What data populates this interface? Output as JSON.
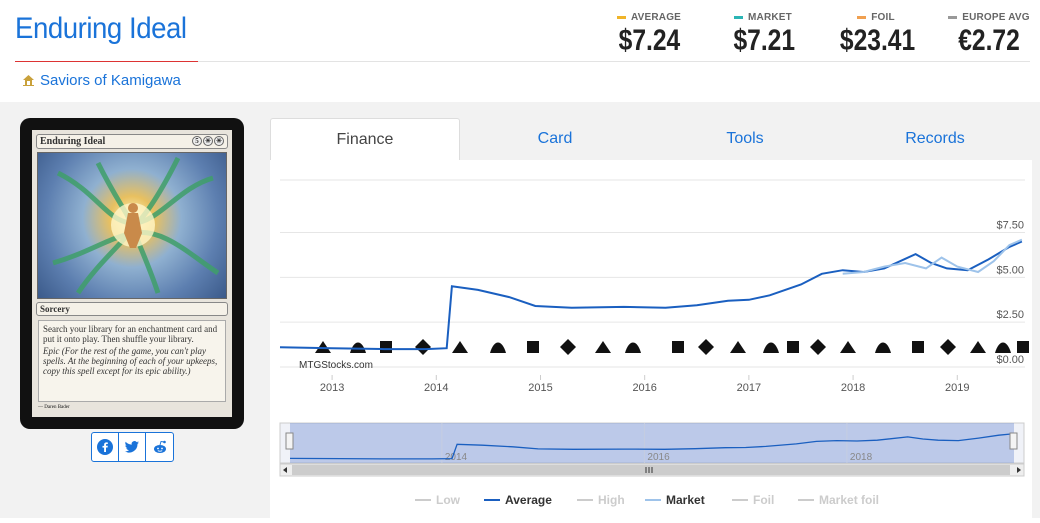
{
  "card": {
    "title": "Enduring Ideal",
    "set_name": "Saviors of Kamigawa",
    "image": {
      "name": "Enduring Ideal",
      "mana": [
        "5",
        "W",
        "W"
      ],
      "type_line": "Sorcery",
      "rules_text": "Search your library for an enchantment card and put it onto play. Then shuffle your library.",
      "epic_text": "Epic (For the rest of the game, you can't play spells. At the beginning of each of your upkeeps, copy this spell except for its epic ability.)",
      "artist": "Daren Bader"
    }
  },
  "prices": [
    {
      "label": "AVERAGE",
      "value": "$7.24",
      "color": "#f0b429"
    },
    {
      "label": "MARKET",
      "value": "$7.21",
      "color": "#2bb5b5"
    },
    {
      "label": "FOIL",
      "value": "$23.41",
      "color": "#f0a050"
    },
    {
      "label": "EUROPE AVG",
      "value": "€2.72",
      "color": "#999999"
    }
  ],
  "tabs": [
    {
      "label": "Finance",
      "active": true
    },
    {
      "label": "Card",
      "active": false
    },
    {
      "label": "Tools",
      "active": false
    },
    {
      "label": "Records",
      "active": false
    }
  ],
  "share": [
    "facebook-icon",
    "twitter-icon",
    "reddit-icon"
  ],
  "chart_data": {
    "type": "line",
    "watermark": "MTGStocks.com",
    "ylim": [
      0,
      8.2
    ],
    "y_ticks": [
      {
        "value": 0,
        "label": "$0.00"
      },
      {
        "value": 2.5,
        "label": "$2.50"
      },
      {
        "value": 5,
        "label": "$5.00"
      },
      {
        "value": 7.5,
        "label": "$7.50"
      }
    ],
    "xlim": [
      2012.5,
      2019.65
    ],
    "x_ticks": [
      {
        "value": 2013,
        "label": "2013"
      },
      {
        "value": 2014,
        "label": "2014"
      },
      {
        "value": 2015,
        "label": "2015"
      },
      {
        "value": 2016,
        "label": "2016"
      },
      {
        "value": 2017,
        "label": "2017"
      },
      {
        "value": 2018,
        "label": "2018"
      },
      {
        "value": 2019,
        "label": "2019"
      }
    ],
    "navigator_ticks": [
      {
        "value": 2014,
        "label": "2014"
      },
      {
        "value": 2016,
        "label": "2016"
      },
      {
        "value": 2018,
        "label": "2018"
      }
    ],
    "series": [
      {
        "name": "Average",
        "color": "#1a5fc0",
        "points": [
          [
            2012.5,
            1.1
          ],
          [
            2013.0,
            1.05
          ],
          [
            2013.5,
            1.0
          ],
          [
            2013.9,
            1.0
          ],
          [
            2014.1,
            1.05
          ],
          [
            2014.15,
            4.5
          ],
          [
            2014.4,
            4.3
          ],
          [
            2014.7,
            3.9
          ],
          [
            2014.95,
            3.4
          ],
          [
            2015.3,
            3.3
          ],
          [
            2015.8,
            3.35
          ],
          [
            2016.2,
            3.3
          ],
          [
            2016.5,
            3.45
          ],
          [
            2016.8,
            3.7
          ],
          [
            2017.0,
            3.75
          ],
          [
            2017.2,
            4.0
          ],
          [
            2017.5,
            4.6
          ],
          [
            2017.7,
            5.2
          ],
          [
            2017.9,
            5.4
          ],
          [
            2018.1,
            5.3
          ],
          [
            2018.3,
            5.5
          ],
          [
            2018.6,
            6.3
          ],
          [
            2018.75,
            5.8
          ],
          [
            2018.9,
            5.5
          ],
          [
            2019.1,
            5.4
          ],
          [
            2019.3,
            6.0
          ],
          [
            2019.5,
            6.7
          ],
          [
            2019.62,
            7.0
          ]
        ]
      },
      {
        "name": "Market",
        "color": "#9ec3ea",
        "points": [
          [
            2017.9,
            5.2
          ],
          [
            2018.1,
            5.3
          ],
          [
            2018.3,
            5.6
          ],
          [
            2018.5,
            5.8
          ],
          [
            2018.7,
            5.5
          ],
          [
            2018.85,
            6.1
          ],
          [
            2019.0,
            5.6
          ],
          [
            2019.2,
            5.3
          ],
          [
            2019.35,
            5.9
          ],
          [
            2019.5,
            6.8
          ],
          [
            2019.62,
            7.1
          ]
        ]
      }
    ],
    "set_symbols_row": "mixed set icons along x-axis",
    "legend": [
      {
        "label": "Low",
        "active": false
      },
      {
        "label": "Average",
        "active": true,
        "color": "#1a5fc0"
      },
      {
        "label": "High",
        "active": false
      },
      {
        "label": "Market",
        "active": true,
        "color": "#9ec3ea"
      },
      {
        "label": "Foil",
        "active": false
      },
      {
        "label": "Market foil",
        "active": false
      }
    ]
  }
}
